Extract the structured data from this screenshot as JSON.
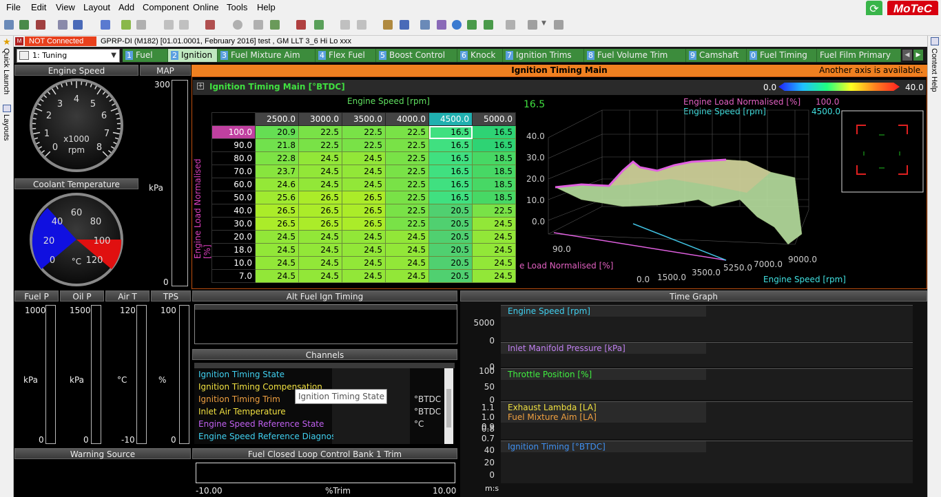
{
  "menu": {
    "items": [
      "File",
      "Edit",
      "View",
      "Layout",
      "Add",
      "Component",
      "Online",
      "Tools",
      "Help"
    ]
  },
  "brand": {
    "logo": "MoTeC"
  },
  "status": {
    "connection": "NOT Connected",
    "ecu_info": "GPRP-DI (M182) [01.01.0001, February 2016] test , GM LLT 3_6 Hi Lo xxx"
  },
  "side": {
    "quick_launch": "Quick Launch",
    "layouts": "Layouts",
    "context_help": "Context Help"
  },
  "workspace": {
    "selected": "1: Tuning"
  },
  "tabs": [
    {
      "num": "1",
      "label": "Fuel"
    },
    {
      "num": "2",
      "label": "Ignition"
    },
    {
      "num": "3",
      "label": "Fuel Mixture Aim"
    },
    {
      "num": "4",
      "label": "Flex Fuel"
    },
    {
      "num": "5",
      "label": "Boost Control"
    },
    {
      "num": "6",
      "label": "Knock"
    },
    {
      "num": "7",
      "label": "Ignition Trims"
    },
    {
      "num": "8",
      "label": "Fuel Volume Trim"
    },
    {
      "num": "9",
      "label": "Camshaft"
    },
    {
      "num": "0",
      "label": "Fuel Timing"
    },
    {
      "num": "",
      "label": "Fuel Film Primary"
    }
  ],
  "gauges": {
    "engine_speed": {
      "title": "Engine Speed",
      "ticks": [
        "0",
        "1",
        "2",
        "3",
        "4",
        "5",
        "6",
        "7",
        "8"
      ],
      "unit1": "x1000",
      "unit2": "rpm"
    },
    "coolant": {
      "title": "Coolant Temperature",
      "ticks": [
        "0",
        "20",
        "40",
        "60",
        "80",
        "100",
        "120"
      ],
      "unit": "°C"
    },
    "map": {
      "title": "MAP",
      "max": "300",
      "min": "0",
      "unit": "kPa"
    },
    "fuel_p": {
      "title": "Fuel P",
      "max": "1000",
      "min": "0",
      "unit": "kPa"
    },
    "oil_p": {
      "title": "Oil P",
      "max": "1500",
      "min": "0",
      "unit": "kPa"
    },
    "air_t": {
      "title": "Air T",
      "max": "120",
      "min": "-10",
      "unit": "°C"
    },
    "tps": {
      "title": "TPS",
      "max": "100",
      "min": "0",
      "unit": "%"
    }
  },
  "ign": {
    "header": "Ignition Timing Main",
    "axis_note": "Another axis is available.",
    "title": "Ignition Timing Main [°BTDC]",
    "scale_min": "0.0",
    "scale_max": "40.0",
    "x_axis": "Engine Speed [rpm]",
    "y_axis": "Engine Load Normalised [%]",
    "cols": [
      "2500.0",
      "3000.0",
      "3500.0",
      "4000.0",
      "4500.0",
      "5000.0"
    ],
    "rows": [
      {
        "load": "100.0",
        "v": [
          "20.9",
          "22.5",
          "22.5",
          "22.5",
          "16.5",
          "16.5"
        ]
      },
      {
        "load": "90.0",
        "v": [
          "21.8",
          "22.5",
          "22.5",
          "22.5",
          "16.5",
          "16.5"
        ]
      },
      {
        "load": "80.0",
        "v": [
          "22.8",
          "24.5",
          "24.5",
          "22.5",
          "16.5",
          "18.5"
        ]
      },
      {
        "load": "70.0",
        "v": [
          "23.7",
          "24.5",
          "24.5",
          "22.5",
          "16.5",
          "18.5"
        ]
      },
      {
        "load": "60.0",
        "v": [
          "24.6",
          "24.5",
          "24.5",
          "22.5",
          "16.5",
          "18.5"
        ]
      },
      {
        "load": "50.0",
        "v": [
          "25.6",
          "26.5",
          "26.5",
          "22.5",
          "16.5",
          "18.5"
        ]
      },
      {
        "load": "40.0",
        "v": [
          "26.5",
          "26.5",
          "26.5",
          "22.5",
          "20.5",
          "22.5"
        ]
      },
      {
        "load": "30.0",
        "v": [
          "26.5",
          "26.5",
          "26.5",
          "22.5",
          "20.5",
          "24.5"
        ]
      },
      {
        "load": "20.0",
        "v": [
          "24.5",
          "24.5",
          "24.5",
          "24.5",
          "20.5",
          "24.5"
        ]
      },
      {
        "load": "18.0",
        "v": [
          "24.5",
          "24.5",
          "24.5",
          "24.5",
          "20.5",
          "24.5"
        ]
      },
      {
        "load": "10.0",
        "v": [
          "24.5",
          "24.5",
          "24.5",
          "24.5",
          "20.5",
          "24.5"
        ]
      },
      {
        "load": "7.0",
        "v": [
          "24.5",
          "24.5",
          "24.5",
          "24.5",
          "20.5",
          "24.5"
        ]
      }
    ],
    "plot": {
      "current_value": "16.5",
      "load_label": "Engine Load Normalised [%]",
      "load_value": "100.0",
      "speed_label": "Engine Speed [rpm]",
      "speed_value": "4500.0",
      "z_ticks": [
        "40.0",
        "30.0",
        "20.0",
        "10.0",
        "0.0"
      ],
      "x_ticks": [
        "0.0",
        "1500.0",
        "3500.0",
        "5250.0",
        "7000.0",
        "9000.0"
      ],
      "y_tick": "90.0",
      "y_axis_clipped": "e Load Normalised [%]",
      "x_axis_clipped": "Engine Speed [rpm]"
    }
  },
  "alt": {
    "title": "Alt Fuel Ign Timing"
  },
  "channels": {
    "title": "Channels",
    "items": [
      {
        "name": "Ignition Timing State",
        "color": "#40d0f0",
        "unit": ""
      },
      {
        "name": "Ignition Timing Compensation",
        "color": "#f0e040",
        "unit": "°BTDC"
      },
      {
        "name": "Ignition Timing Trim",
        "color": "#f0a040",
        "unit": "°BTDC"
      },
      {
        "name": "Inlet Air Temperature",
        "color": "#f0e040",
        "unit": "°C"
      },
      {
        "name": "Engine Speed Reference State",
        "color": "#c060f0",
        "unit": ""
      },
      {
        "name": "Engine Speed Reference Diagnostic",
        "color": "#40d0f0",
        "unit": ""
      }
    ],
    "tooltip": "Ignition Timing State"
  },
  "warning": {
    "title": "Warning Source"
  },
  "fclc": {
    "title": "Fuel Closed Loop Control Bank 1 Trim",
    "min": "-10.00",
    "unit": "%Trim",
    "max": "10.00"
  },
  "timegraph": {
    "title": "Time Graph",
    "x_unit": "m:s",
    "channels": [
      {
        "name": "Engine Speed [rpm]",
        "color": "#40d0f0",
        "ticks": [
          "5000",
          "0"
        ]
      },
      {
        "name": "Inlet Manifold Pressure [kPa]",
        "color": "#c080f0",
        "ticks": [
          "0"
        ]
      },
      {
        "name": "Throttle Position [%]",
        "color": "#40f040",
        "ticks": [
          "100",
          "50",
          "0"
        ]
      },
      {
        "name": "Exhaust Lambda [LA]",
        "color": "#f0e040",
        "ticks": [
          "1.1",
          "1.0",
          "0.9",
          "0.8",
          "0.7"
        ]
      },
      {
        "name": "Fuel Mixture Aim [LA]",
        "color": "#f0a040",
        "ticks": []
      },
      {
        "name": "Ignition Timing [°BTDC]",
        "color": "#4090f0",
        "ticks": [
          "40",
          "20",
          "0"
        ]
      }
    ]
  }
}
